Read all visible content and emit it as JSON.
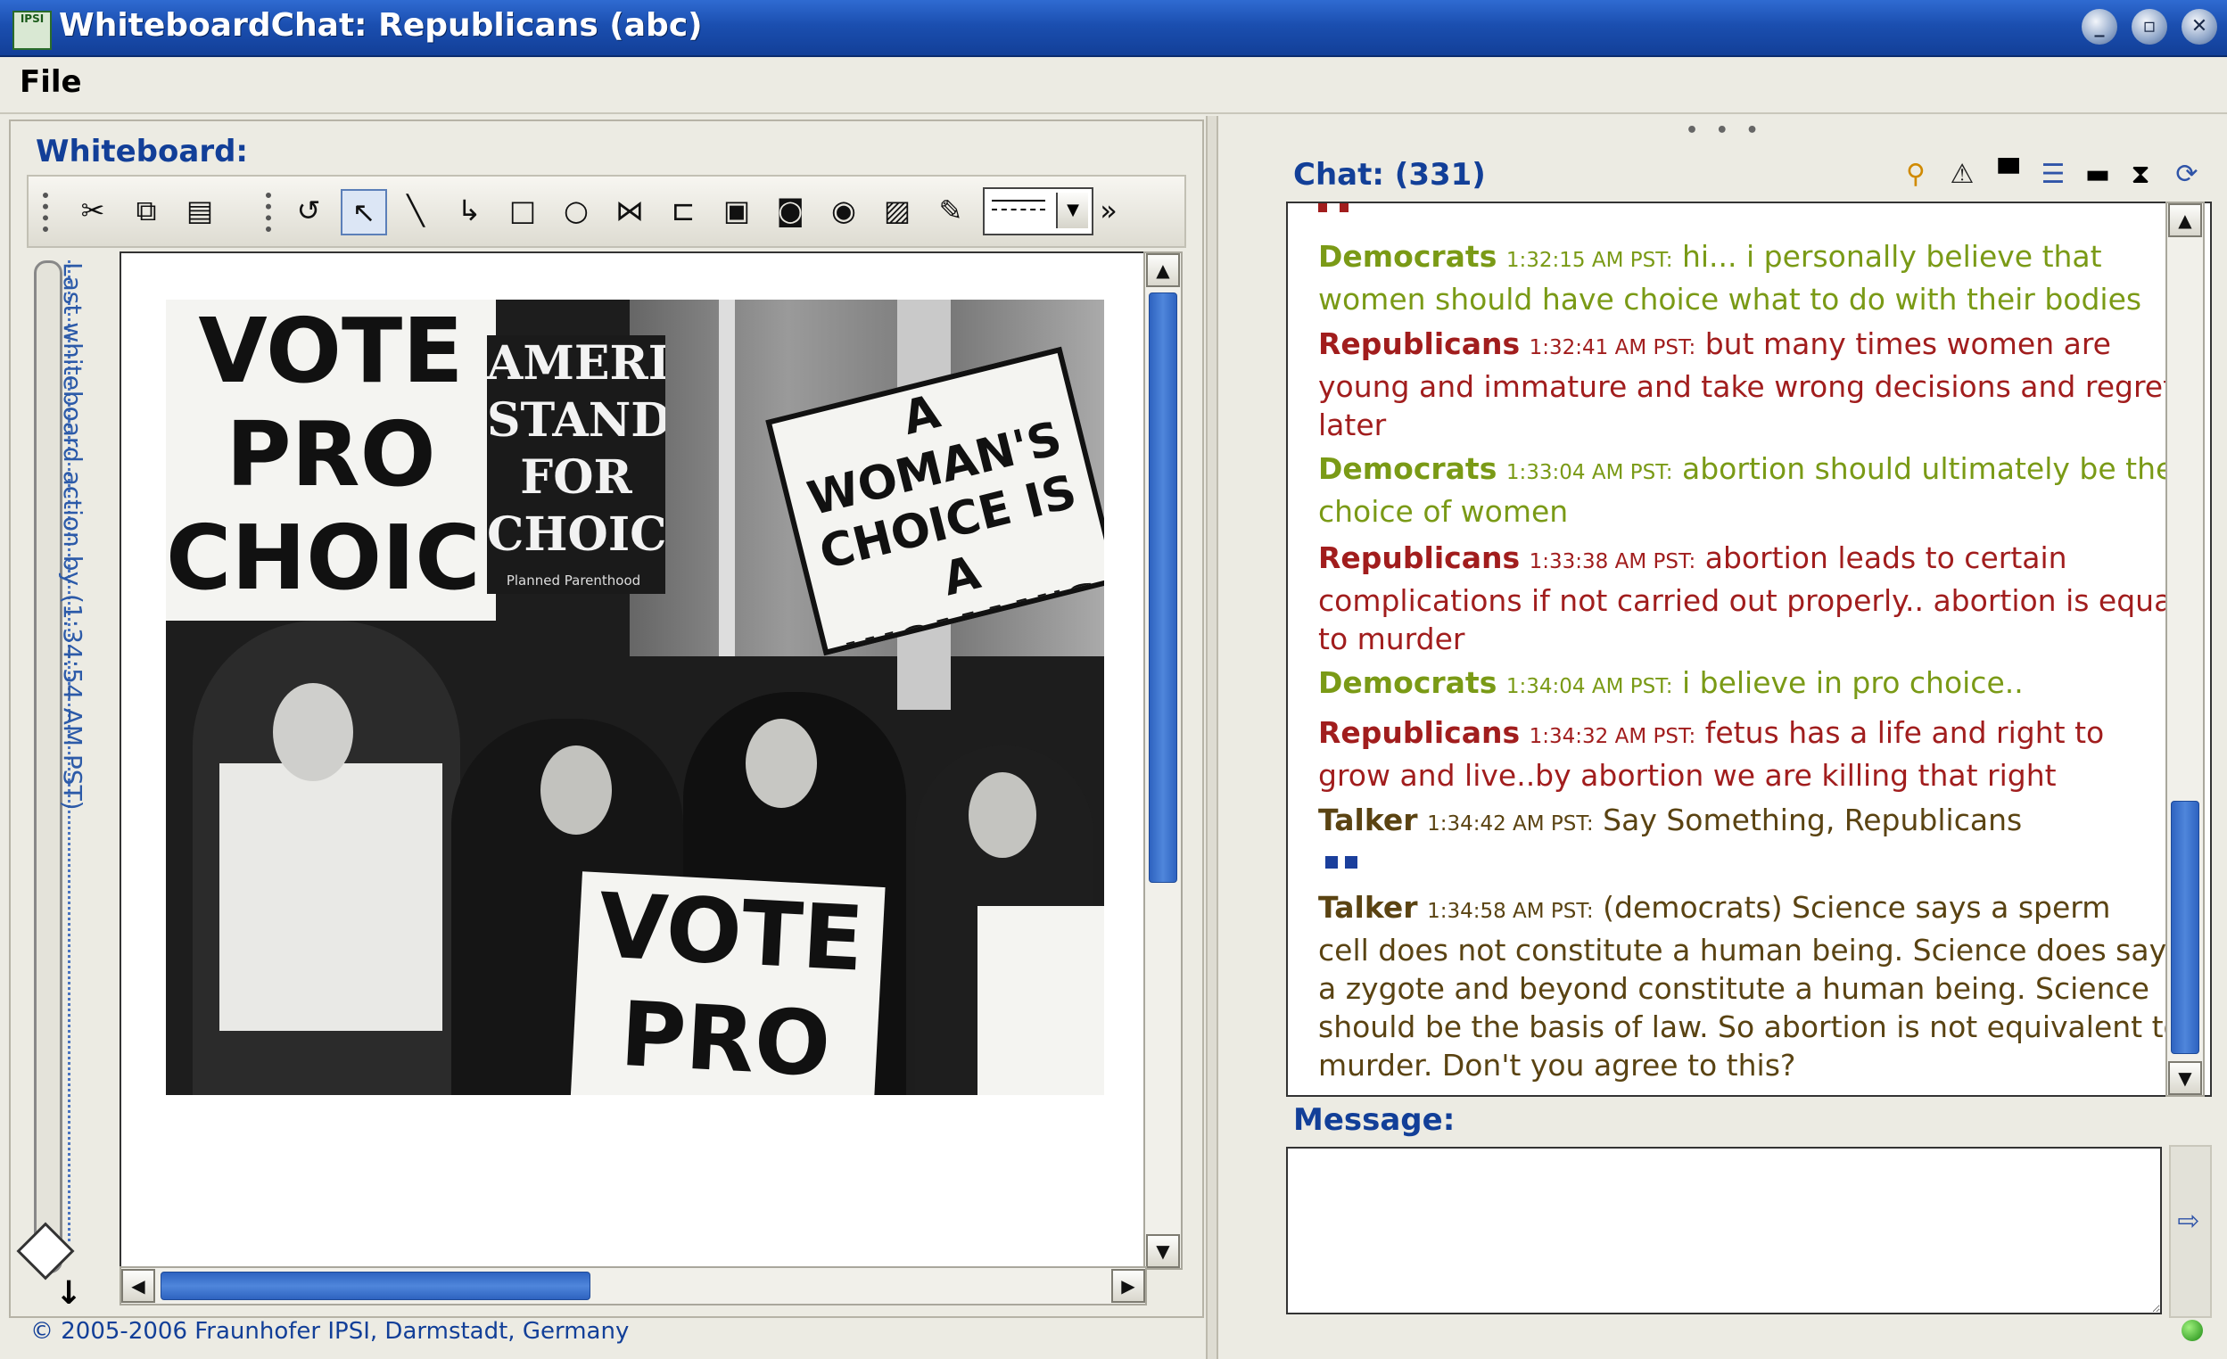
{
  "window": {
    "title": "WhiteboardChat: Republicans (abc)",
    "app_icon_text": "IPSI"
  },
  "menu": {
    "file": "File"
  },
  "whiteboard": {
    "label": "Whiteboard:",
    "history_text": "Last whiteboard action by  (1:34:54 AM PST)",
    "copyright": "© 2005-2006 Fraunhofer IPSI, Darmstadt, Germany",
    "image_sign_texts": [
      "VOTE PRO CHOICE",
      "AMERICA STANDS FOR CHOICE",
      "Planned Parenthood",
      "A WOMAN'S CHOICE IS A WOMAN'S VOICE",
      "VOTE PRO"
    ]
  },
  "chat": {
    "label": "Chat: (331)",
    "messages": [
      {
        "sender": "Democrats",
        "time": "1:32:15 AM PST:",
        "lines": [
          "hi... i personally believe that",
          "women should have choice what to do with their bodies"
        ],
        "party": "dem"
      },
      {
        "sender": "Republicans",
        "time": "1:32:41 AM PST:",
        "lines": [
          "but many times women are",
          "young and immature and take wrong decisions and regret",
          "later"
        ],
        "party": "rep"
      },
      {
        "sender": "Democrats",
        "time": "1:33:04 AM PST:",
        "lines": [
          "abortion should ultimately be the",
          "choice of women"
        ],
        "party": "dem"
      },
      {
        "sender": "Republicans",
        "time": "1:33:38 AM PST:",
        "lines": [
          "abortion leads to certain",
          "complications if not carried out properly.. abortion is equal",
          "to murder"
        ],
        "party": "rep"
      },
      {
        "sender": "Democrats",
        "time": "1:34:04 AM PST:",
        "lines": [
          "i believe in pro choice.."
        ],
        "party": "dem"
      },
      {
        "sender": "Republicans",
        "time": "1:34:32 AM PST:",
        "lines": [
          "fetus has a life and right to",
          "grow and live..by abortion we are killing that right"
        ],
        "party": "rep"
      },
      {
        "sender": "Talker",
        "time": "1:34:42 AM PST:",
        "lines": [
          "Say Something, Republicans"
        ],
        "party": "tlk"
      },
      {
        "sender": "Talker",
        "time": "1:34:58 AM PST:",
        "lines": [
          "(democrats) Science says a sperm",
          "cell does not constitute a human being. Science does say",
          "a zygote and beyond constitute a human being. Science",
          "should be the basis of law. So abortion is not equivalent to",
          "murder. Don't you agree to this?"
        ],
        "party": "tlk"
      }
    ]
  },
  "message": {
    "label": "Message:",
    "value": ""
  },
  "colors": {
    "democrats": "#7a9a16",
    "republicans": "#a11d1d",
    "talker": "#5a4312",
    "accent": "#123f98"
  }
}
